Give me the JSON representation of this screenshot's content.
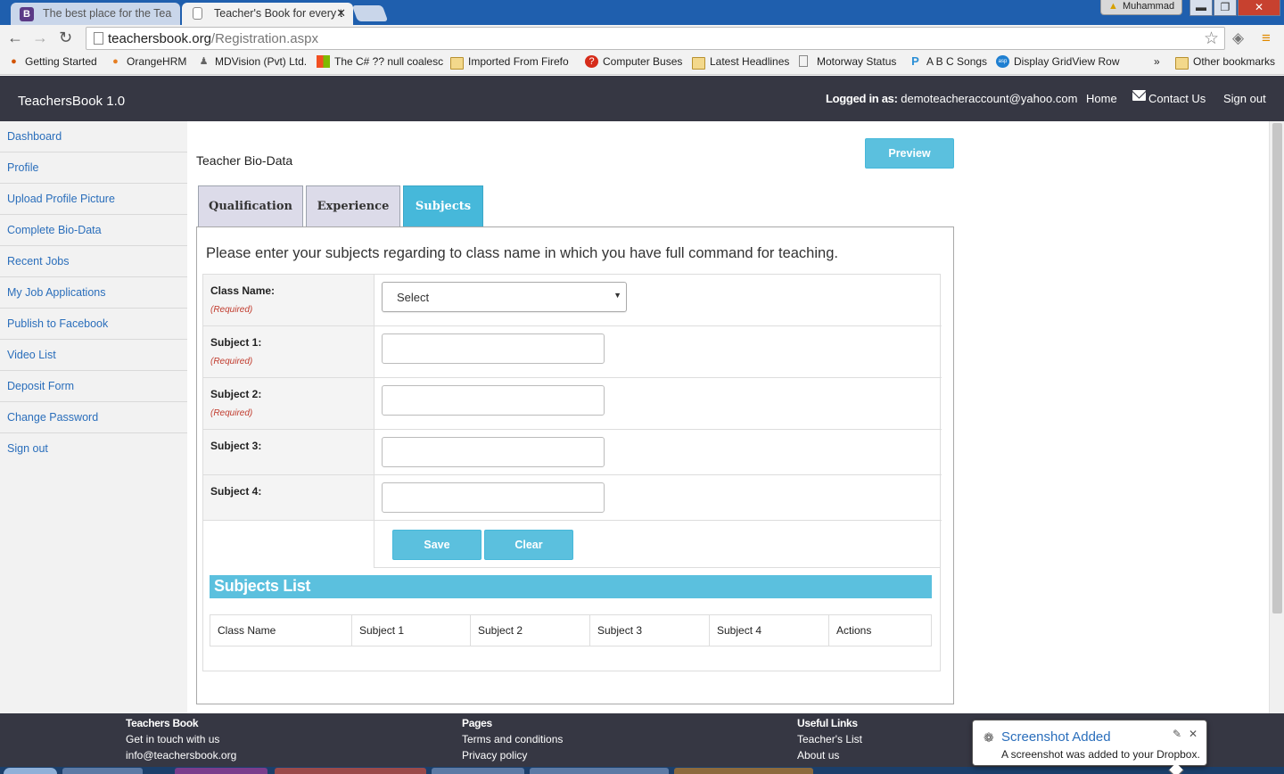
{
  "browser": {
    "tabs": [
      {
        "title": "The best place for the Tea",
        "favicon": "B"
      },
      {
        "title": "Teacher's Book for every t"
      }
    ],
    "user_name": "Muhammad",
    "url_host": "teachersbook.org",
    "url_path": "/Registration.aspx",
    "bookmarks": [
      {
        "label": "Getting Started",
        "icon": "firefox-icon"
      },
      {
        "label": "OrangeHRM",
        "icon": "orange-icon"
      },
      {
        "label": "MDVision (Pvt) Ltd.",
        "icon": "mdvision-icon"
      },
      {
        "label": "The C# ?? null coalesc",
        "icon": "windows-icon"
      },
      {
        "label": "Imported From Firefo",
        "icon": "folder-icon"
      },
      {
        "label": "Computer Buses",
        "icon": "help-icon"
      },
      {
        "label": "Latest Headlines",
        "icon": "folder-icon"
      },
      {
        "label": "Motorway Status",
        "icon": "page-icon"
      },
      {
        "label": "A B C Songs",
        "icon": "p-icon"
      },
      {
        "label": "Display GridView Row",
        "icon": "asp-icon"
      }
    ],
    "more_bookmarks": "»",
    "other_bookmarks": "Other bookmarks"
  },
  "header": {
    "brand": "TeachersBook 1.0",
    "logged_in_label": "Logged in as:",
    "logged_in_email": "demoteacheraccount@yahoo.com",
    "home": "Home",
    "contact": "Contact Us",
    "signout": "Sign out"
  },
  "sidebar": {
    "items": [
      "Dashboard",
      "Profile",
      "Upload Profile Picture",
      "Complete Bio-Data",
      "Recent Jobs",
      "My Job Applications",
      "Publish to Facebook",
      "Video List",
      "Deposit Form",
      "Change Password",
      "Sign out"
    ]
  },
  "main": {
    "title": "Teacher Bio-Data",
    "preview": "Preview",
    "tabs": [
      "Qualification",
      "Experience",
      "Subjects"
    ],
    "active_tab": "Subjects",
    "instruction": "Please enter your subjects regarding to class name in which you have full command for teaching.",
    "form": {
      "class_label": "Class Name:",
      "class_value": "Select",
      "required": "(Required)",
      "subject1_label": "Subject 1:",
      "subject2_label": "Subject 2:",
      "subject3_label": "Subject 3:",
      "subject4_label": "Subject 4:",
      "subject1_value": "",
      "subject2_value": "",
      "subject3_value": "",
      "subject4_value": "",
      "save": "Save",
      "clear": "Clear"
    },
    "subjects_list": {
      "heading": "Subjects List",
      "columns": [
        "Class Name",
        "Subject 1",
        "Subject 2",
        "Subject 3",
        "Subject 4",
        "Actions"
      ]
    }
  },
  "footer": {
    "col1": {
      "heading": "Teachers Book",
      "lines": [
        "Get in touch with us",
        "info@teachersbook.org"
      ]
    },
    "col2": {
      "heading": "Pages",
      "lines": [
        "Terms and conditions",
        "Privacy policy"
      ]
    },
    "col3": {
      "heading": "Useful Links",
      "lines": [
        "Teacher's List",
        "About us"
      ]
    }
  },
  "toast": {
    "title": "Screenshot Added",
    "message": "A screenshot was added to your Dropbox."
  },
  "colors": {
    "header_bg": "#363743",
    "accent": "#5bc0de",
    "link": "#2a6ebb",
    "required": "#c0392b"
  }
}
